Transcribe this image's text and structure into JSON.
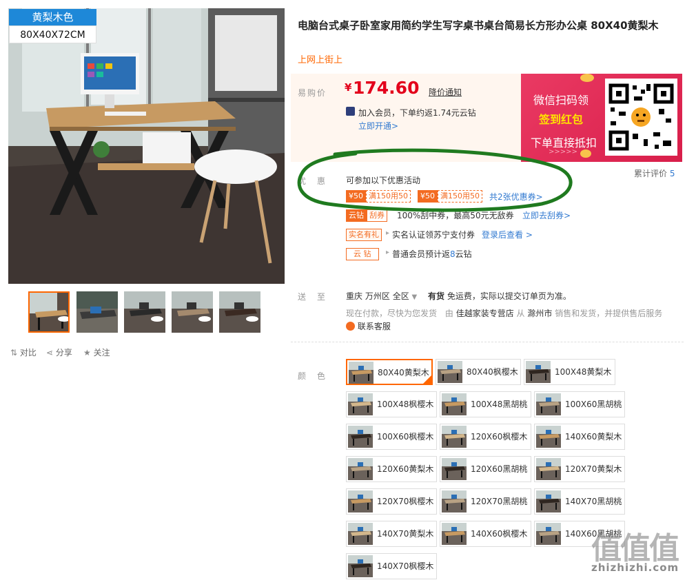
{
  "gallery": {
    "badge_wood": "黄梨木色",
    "badge_size": "80X40X72CM",
    "thumbs": [
      "thumb-1",
      "thumb-2",
      "thumb-3",
      "thumb-4",
      "thumb-5"
    ]
  },
  "toolbar": {
    "compare": "对比",
    "share": "分享",
    "follow": "关注"
  },
  "product": {
    "title": "电脑台式桌子卧室家用简约学生写字桌书桌台简易长方形办公桌 80X40黄梨木",
    "subtitle": "上网上街上"
  },
  "price_box": {
    "label": "易购价",
    "currency": "¥",
    "price": "174.60",
    "alert_link": "降价通知",
    "member_text": "加入会员，下单约返1.74元云钻",
    "member_link": "立即开通>"
  },
  "promo_banner": {
    "line1": "微信扫码领",
    "line2": "签到红包",
    "line3": "下单直接抵扣",
    "arrows": ">>>>>"
  },
  "reviews": {
    "label": "累计评价",
    "count": "5"
  },
  "discount": {
    "label": "优惠",
    "intro": "可参加以下优惠活动",
    "coupons": [
      {
        "amount": "¥50",
        "cond": "满150用50"
      },
      {
        "amount": "¥50",
        "cond": "满150用50"
      }
    ],
    "coupons_link": "共2张优惠券>",
    "yunzuan_tag": "云钻",
    "scratch_tag": "刮券",
    "scratch_text": "100%刮中券，最高50元无敌券",
    "scratch_link": "立即去刮券>",
    "realname_tag": "实名有礼",
    "realname_text": "实名认证领苏宁支付券",
    "realname_link": "登录后查看 >",
    "cloud_tag": "云 钻",
    "cloud_text_prefix": "普通会员预计返",
    "cloud_num": "8",
    "cloud_text_suffix": "云钻"
  },
  "delivery": {
    "label": "送至",
    "city": "重庆",
    "district": "万州区",
    "area": "全区",
    "stock": "有货",
    "freight": "免运费，实际以提交订单页为准。",
    "note_prefix": "现在付款，尽快为您发货",
    "from_text": "由",
    "shop": "佳越家装专营店",
    "from_city_pre": "从",
    "from_city": "滁州市",
    "note_suffix": "销售和发货，并提供售后服务",
    "service": "联系客服"
  },
  "color": {
    "label": "颜色",
    "options": [
      "80X40黄梨木",
      "80X40枫樱木",
      "100X48黄梨木",
      "100X48枫樱木",
      "100X48黑胡桃",
      "100X60黑胡桃",
      "100X60枫樱木",
      "120X60枫樱木",
      "140X60黄梨木",
      "120X60黄梨木",
      "120X60黑胡桃",
      "120X70黄梨木",
      "120X70枫樱木",
      "120X70黑胡桃",
      "140X70黑胡桃",
      "140X70黄梨木",
      "140X60枫樱木",
      "140X60黑胡桃",
      "140X70枫樱木"
    ],
    "selected_index": 0
  },
  "watermark": {
    "big": "值值值",
    "site": "zhizhizhi.com"
  },
  "colors": {
    "accent": "#ff6600",
    "price": "#e3001b",
    "link": "#3179d0",
    "promo": "#e4285a",
    "green_circle": "#1f7a1f"
  }
}
